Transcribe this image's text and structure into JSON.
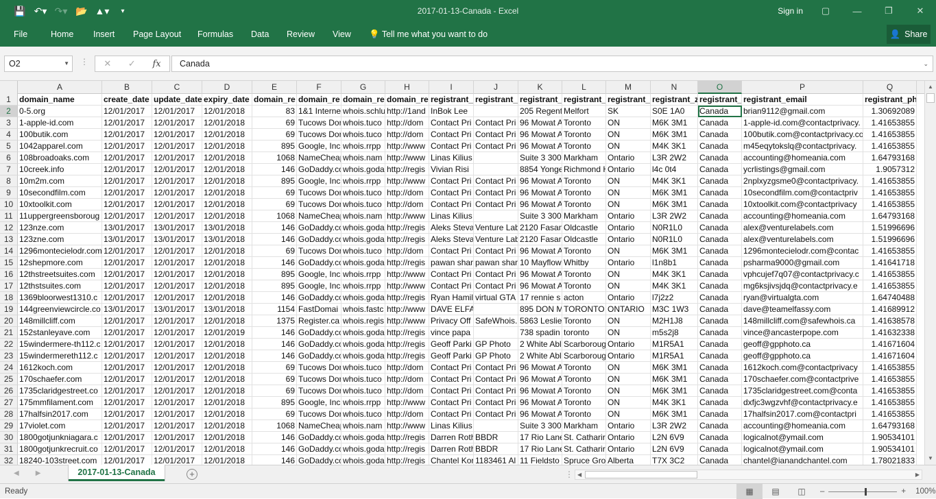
{
  "window": {
    "title": "2017-01-13-Canada  -  Excel",
    "signin": "Sign in"
  },
  "ribbon": {
    "tabs": [
      "File",
      "Home",
      "Insert",
      "Page Layout",
      "Formulas",
      "Data",
      "Review",
      "View"
    ],
    "tellme": "Tell me what you want to do",
    "share": "Share"
  },
  "formula_bar": {
    "name_box": "O2",
    "value": "Canada",
    "fx": "fx"
  },
  "sheet": {
    "columns": [
      "A",
      "B",
      "C",
      "D",
      "E",
      "F",
      "G",
      "H",
      "I",
      "J",
      "K",
      "L",
      "M",
      "N",
      "O",
      "P",
      "Q"
    ],
    "rows": [
      [
        "1",
        "domain_name",
        "create_date",
        "update_date",
        "expiry_date",
        "domain_re",
        "domain_re",
        "domain_re",
        "domain_re",
        "registrant_r",
        "registrant_c",
        "registrant_a",
        "registrant_",
        "registrant_",
        "registrant_z",
        "registrant_",
        "registrant_email",
        "registrant_ph"
      ],
      [
        "2",
        "0-5.org",
        "12/01/2017",
        "12/01/2017",
        "12/01/2018",
        "83",
        "1&1 Interne",
        "whois.schlu",
        "http://1and",
        "InBok Lee",
        "",
        "205 Regent",
        "Melfort",
        "SK",
        "S0E 1A0",
        "Canada",
        "brian9112@gmail.com",
        "1.30692089"
      ],
      [
        "3",
        "1-apple-id.com",
        "12/01/2017",
        "12/01/2017",
        "12/01/2018",
        "69",
        "Tucows Dor",
        "whois.tuco",
        "http://dom",
        "Contact Pri",
        "Contact Pri",
        "96 Mowat A",
        "Toronto",
        "ON",
        "M6K 3M1",
        "Canada",
        "1-apple-id.com@contactprivacy.",
        "1.41653855"
      ],
      [
        "4",
        "100butik.com",
        "12/01/2017",
        "12/01/2017",
        "12/01/2018",
        "69",
        "Tucows Dor",
        "whois.tuco",
        "http://dom",
        "Contact Pri",
        "Contact Pri",
        "96 Mowat A",
        "Toronto",
        "ON",
        "M6K 3M1",
        "Canada",
        "100butik.com@contactprivacy.co",
        "1.41653855"
      ],
      [
        "5",
        "1042apparel.com",
        "12/01/2017",
        "12/01/2017",
        "12/01/2018",
        "895",
        "Google, Inc",
        "whois.rrpp",
        "http://www",
        "Contact Pri",
        "Contact Pri",
        "96 Mowat A",
        "Toronto",
        "ON",
        "M4K 3K1",
        "Canada",
        "m45eqytokslq@contactprivacy.",
        "1.41653855"
      ],
      [
        "6",
        "108broadoaks.com",
        "12/01/2017",
        "12/01/2017",
        "12/01/2018",
        "1068",
        "NameCheap",
        "whois.nam",
        "http://www",
        "Linas Kilius",
        "",
        "Suite 3 300",
        "Markham",
        "Ontario",
        "L3R 2W2",
        "Canada",
        "accounting@homeania.com",
        "1.64793168"
      ],
      [
        "7",
        "10creek.info",
        "12/01/2017",
        "12/01/2017",
        "12/01/2018",
        "146",
        "GoDaddy.co",
        "whois.goda",
        "http://regis",
        "Vivian Risi",
        "",
        "8854 Yonge",
        "Richmond H",
        "Ontario",
        "l4c 0t4",
        "Canada",
        "ycrlistings@gmail.com",
        "1.9057312"
      ],
      [
        "8",
        "10m2m.com",
        "12/01/2017",
        "12/01/2017",
        "12/01/2018",
        "895",
        "Google, Inc",
        "whois.rrpp",
        "http://www",
        "Contact Pri",
        "Contact Pri",
        "96 Mowat A",
        "Toronto",
        "ON",
        "M4K 3K1",
        "Canada",
        "2nplxyzgsme0@contactprivacy.",
        "1.41653855"
      ],
      [
        "9",
        "10secondfilm.com",
        "12/01/2017",
        "12/01/2017",
        "12/01/2018",
        "69",
        "Tucows Dor",
        "whois.tuco",
        "http://dom",
        "Contact Pri",
        "Contact Pri",
        "96 Mowat A",
        "Toronto",
        "ON",
        "M6K 3M1",
        "Canada",
        "10secondfilm.com@contactpriv",
        "1.41653855"
      ],
      [
        "10",
        "10xtoolkit.com",
        "12/01/2017",
        "12/01/2017",
        "12/01/2018",
        "69",
        "Tucows Dor",
        "whois.tuco",
        "http://dom",
        "Contact Pri",
        "Contact Pri",
        "96 Mowat A",
        "Toronto",
        "ON",
        "M6K 3M1",
        "Canada",
        "10xtoolkit.com@contactprivacy",
        "1.41653855"
      ],
      [
        "11",
        "11uppergreensboroug",
        "12/01/2017",
        "12/01/2017",
        "12/01/2018",
        "1068",
        "NameCheap",
        "whois.nam",
        "http://www",
        "Linas Kilius",
        "",
        "Suite 3 300",
        "Markham",
        "Ontario",
        "L3R 2W2",
        "Canada",
        "accounting@homeania.com",
        "1.64793168"
      ],
      [
        "12",
        "123nze.com",
        "13/01/2017",
        "13/01/2017",
        "13/01/2018",
        "146",
        "GoDaddy.co",
        "whois.goda",
        "http://regis",
        "Aleks Steva",
        "Venture Lab",
        "2120 Fasan",
        "Oldcastle",
        "Ontario",
        "N0R1L0",
        "Canada",
        "alex@venturelabels.com",
        "1.51996696"
      ],
      [
        "13",
        "123zne.com",
        "13/01/2017",
        "13/01/2017",
        "13/01/2018",
        "146",
        "GoDaddy.co",
        "whois.goda",
        "http://regis",
        "Aleks Steva",
        "Venture Lab",
        "2120 Fasan",
        "Oldcastle",
        "Ontario",
        "N0R1L0",
        "Canada",
        "alex@venturelabels.com",
        "1.51996696"
      ],
      [
        "14",
        "1296montecielodr.com",
        "12/01/2017",
        "12/01/2017",
        "12/01/2018",
        "69",
        "Tucows Dor",
        "whois.tuco",
        "http://dom",
        "Contact Pri",
        "Contact Pri",
        "96 Mowat A",
        "Toronto",
        "ON",
        "M6K 3M1",
        "Canada",
        "1296montecielodr.com@contac",
        "1.41653855"
      ],
      [
        "15",
        "12shepmore.com",
        "12/01/2017",
        "12/01/2017",
        "12/01/2018",
        "146",
        "GoDaddy.co",
        "whois.goda",
        "http://regis",
        "pawan shar",
        "pawan shar",
        "10 Mayflow",
        "Whitby",
        "Ontario",
        "l1n8b1",
        "Canada",
        "psharma9000@gmail.com",
        "1.41641718"
      ],
      [
        "16",
        "12thstreetsuites.com",
        "12/01/2017",
        "12/01/2017",
        "12/01/2018",
        "895",
        "Google, Inc",
        "whois.rrpp",
        "http://www",
        "Contact Pri",
        "Contact Pri",
        "96 Mowat A",
        "Toronto",
        "ON",
        "M4K 3K1",
        "Canada",
        "vphcujef7q07@contactprivacy.c",
        "1.41653855"
      ],
      [
        "17",
        "12thstsuites.com",
        "12/01/2017",
        "12/01/2017",
        "12/01/2018",
        "895",
        "Google, Inc",
        "whois.rrpp",
        "http://www",
        "Contact Pri",
        "Contact Pri",
        "96 Mowat A",
        "Toronto",
        "ON",
        "M4K 3K1",
        "Canada",
        "mg6ksjivsjdq@contactprivacy.e",
        "1.41653855"
      ],
      [
        "18",
        "1369bloorwest1310.c",
        "12/01/2017",
        "12/01/2017",
        "12/01/2018",
        "146",
        "GoDaddy.co",
        "whois.goda",
        "http://regis",
        "Ryan Hamil",
        "virtual GTA",
        "17 rennie s",
        "acton",
        "Ontario",
        "l7j2z2",
        "Canada",
        "ryan@virtualgta.com",
        "1.64740488"
      ],
      [
        "19",
        "144greenviewcircle.co",
        "13/01/2017",
        "13/01/2017",
        "13/01/2018",
        "1154",
        "FastDomai",
        "whois.fastc",
        "http://www",
        "DAVE ELFASSY",
        "",
        "895 DON M",
        "TORONTO",
        "ONTARIO",
        "M3C 1W3",
        "Canada",
        "dave@teamelfassy.com",
        "1.41689912"
      ],
      [
        "20",
        "148millcliff.com",
        "12/01/2017",
        "12/01/2017",
        "12/01/2018",
        "1375",
        "Register.ca",
        "whois.regis",
        "http://www",
        "Privacy Off",
        "SafeWhois.",
        "5863 Leslie",
        "Toronto",
        "ON",
        "M2H1J8",
        "Canada",
        "148millcliff.com@safewhois.ca",
        "1.41638578"
      ],
      [
        "21",
        "152stanleyave.com",
        "12/01/2017",
        "12/01/2017",
        "12/01/2019",
        "146",
        "GoDaddy.co",
        "whois.goda",
        "http://regis",
        "vince papa",
        "",
        "738 spadin",
        "toronto",
        "ON",
        "m5s2j8",
        "Canada",
        "vince@ancasterpope.com",
        "1.41632338"
      ],
      [
        "22",
        "15windermere-th112.c",
        "12/01/2017",
        "12/01/2017",
        "12/01/2018",
        "146",
        "GoDaddy.co",
        "whois.goda",
        "http://regis",
        "Geoff Parki",
        "GP Photo",
        "2 White Abl",
        "Scarboroug",
        "Ontario",
        "M1R5A1",
        "Canada",
        "geoff@gpphoto.ca",
        "1.41671604"
      ],
      [
        "23",
        "15windermereth112.c",
        "12/01/2017",
        "12/01/2017",
        "12/01/2018",
        "146",
        "GoDaddy.co",
        "whois.goda",
        "http://regis",
        "Geoff Parki",
        "GP Photo",
        "2 White Abl",
        "Scarboroug",
        "Ontario",
        "M1R5A1",
        "Canada",
        "geoff@gpphoto.ca",
        "1.41671604"
      ],
      [
        "24",
        "1612koch.com",
        "12/01/2017",
        "12/01/2017",
        "12/01/2018",
        "69",
        "Tucows Dor",
        "whois.tuco",
        "http://dom",
        "Contact Pri",
        "Contact Pri",
        "96 Mowat A",
        "Toronto",
        "ON",
        "M6K 3M1",
        "Canada",
        "1612koch.com@contactprivacy",
        "1.41653855"
      ],
      [
        "25",
        "170schaefer.com",
        "12/01/2017",
        "12/01/2017",
        "12/01/2018",
        "69",
        "Tucows Dor",
        "whois.tuco",
        "http://dom",
        "Contact Pri",
        "Contact Pri",
        "96 Mowat A",
        "Toronto",
        "ON",
        "M6K 3M1",
        "Canada",
        "170schaefer.com@contactprive",
        "1.41653855"
      ],
      [
        "26",
        "1735claridgestreet.co",
        "12/01/2017",
        "12/01/2017",
        "12/01/2018",
        "69",
        "Tucows Dor",
        "whois.tuco",
        "http://dom",
        "Contact Pri",
        "Contact Pri",
        "96 Mowat A",
        "Toronto",
        "ON",
        "M6K 3M1",
        "Canada",
        "1735claridgestreet.com@conta",
        "1.41653855"
      ],
      [
        "27",
        "175mmfilament.com",
        "12/01/2017",
        "12/01/2017",
        "12/01/2018",
        "895",
        "Google, Inc",
        "whois.rrpp",
        "http://www",
        "Contact Pri",
        "Contact Pri",
        "96 Mowat A",
        "Toronto",
        "ON",
        "M4K 3K1",
        "Canada",
        "dxfjc3wgzvhf@contactprivacy.e",
        "1.41653855"
      ],
      [
        "28",
        "17halfsin2017.com",
        "12/01/2017",
        "12/01/2017",
        "12/01/2018",
        "69",
        "Tucows Dor",
        "whois.tuco",
        "http://dom",
        "Contact Pri",
        "Contact Pri",
        "96 Mowat A",
        "Toronto",
        "ON",
        "M6K 3M1",
        "Canada",
        "17halfsin2017.com@contactpri",
        "1.41653855"
      ],
      [
        "29",
        "17violet.com",
        "12/01/2017",
        "12/01/2017",
        "12/01/2018",
        "1068",
        "NameCheap",
        "whois.nam",
        "http://www",
        "Linas Kilius",
        "",
        "Suite 3 300",
        "Markham",
        "Ontario",
        "L3R 2W2",
        "Canada",
        "accounting@homeania.com",
        "1.64793168"
      ],
      [
        "30",
        "1800gotjunkniagara.c",
        "12/01/2017",
        "12/01/2017",
        "12/01/2018",
        "146",
        "GoDaddy.co",
        "whois.goda",
        "http://regis",
        "Darren Roth",
        "BBDR",
        "17 Rio Lane",
        "St. Catharir",
        "Ontario",
        "L2N 6V9",
        "Canada",
        "logicalnot@ymail.com",
        "1.90534101"
      ],
      [
        "31",
        "1800gotjunkrecruit.co",
        "12/01/2017",
        "12/01/2017",
        "12/01/2018",
        "146",
        "GoDaddy.co",
        "whois.goda",
        "http://regis",
        "Darren Roth",
        "BBDR",
        "17 Rio Lane",
        "St. Catharir",
        "Ontario",
        "L2N 6V9",
        "Canada",
        "logicalnot@ymail.com",
        "1.90534101"
      ],
      [
        "32",
        "18240-103street.com",
        "12/01/2017",
        "12/01/2017",
        "12/01/2018",
        "146",
        "GoDaddy.co",
        "whois.goda",
        "http://regis",
        "Chantel Kor",
        "1183461 Al",
        "11 Fieldsto",
        "Spruce Gro",
        "Alberta",
        "T7X 3C2",
        "Canada",
        "chantel@ianandchantel.com",
        "1.78021833"
      ]
    ]
  },
  "sheet_tabs": {
    "active": "2017-01-13-Canada"
  },
  "status": {
    "text": "Ready",
    "zoom": "100%"
  }
}
